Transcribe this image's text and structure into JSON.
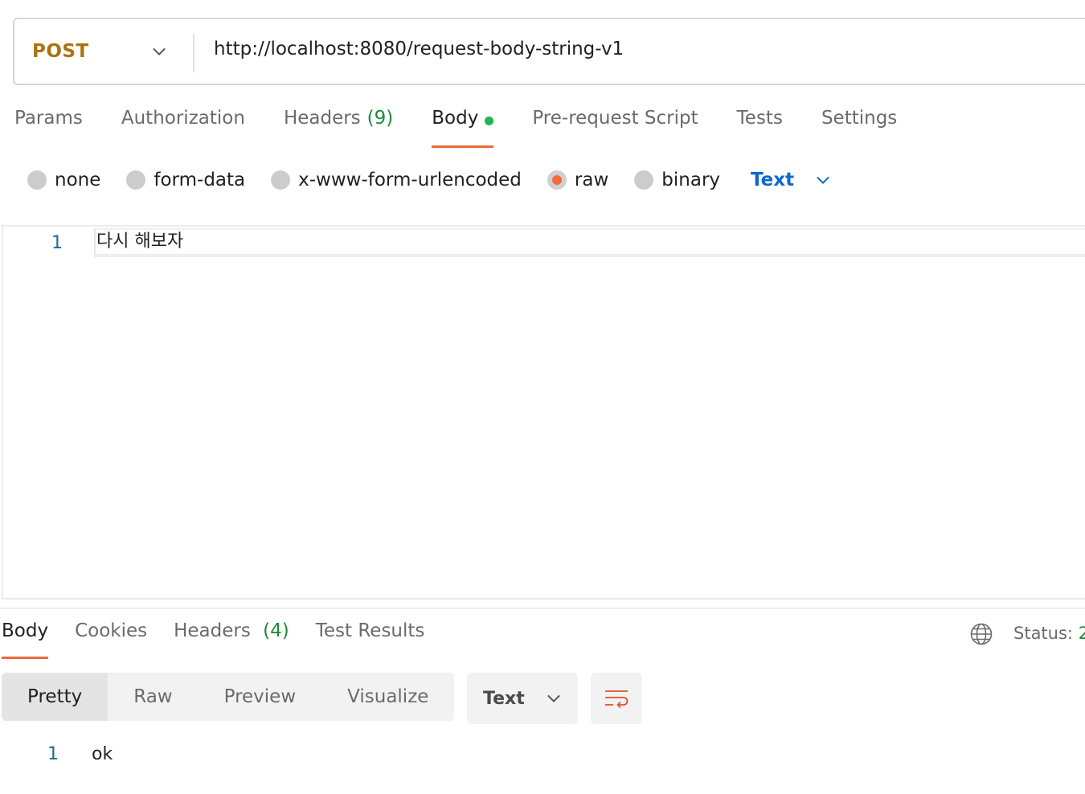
{
  "request": {
    "method": "POST",
    "url": "http://localhost:8080/request-body-string-v1"
  },
  "request_tabs": {
    "params": "Params",
    "authorization": "Authorization",
    "headers": "Headers",
    "headers_count": "(9)",
    "body": "Body",
    "pre_request": "Pre-request Script",
    "tests": "Tests",
    "settings": "Settings"
  },
  "body_types": {
    "none": "none",
    "form_data": "form-data",
    "urlencoded": "x-www-form-urlencoded",
    "raw": "raw",
    "binary": "binary",
    "selected": "raw",
    "language": "Text"
  },
  "editor": {
    "line_number": "1",
    "content": "다시 해보자"
  },
  "response_tabs": {
    "body": "Body",
    "cookies": "Cookies",
    "headers": "Headers",
    "headers_count": "(4)",
    "test_results": "Test Results"
  },
  "status": {
    "label": "Status:",
    "value": "2"
  },
  "response_view": {
    "pretty": "Pretty",
    "raw": "Raw",
    "preview": "Preview",
    "visualize": "Visualize",
    "format": "Text"
  },
  "response_body": {
    "line_number": "1",
    "content": "ok"
  },
  "colors": {
    "method": "#a9740f",
    "accent": "#ec6a3c",
    "count_green": "#1e8b3a",
    "dot_green": "#21b452",
    "link_blue": "#0b6bcb"
  }
}
